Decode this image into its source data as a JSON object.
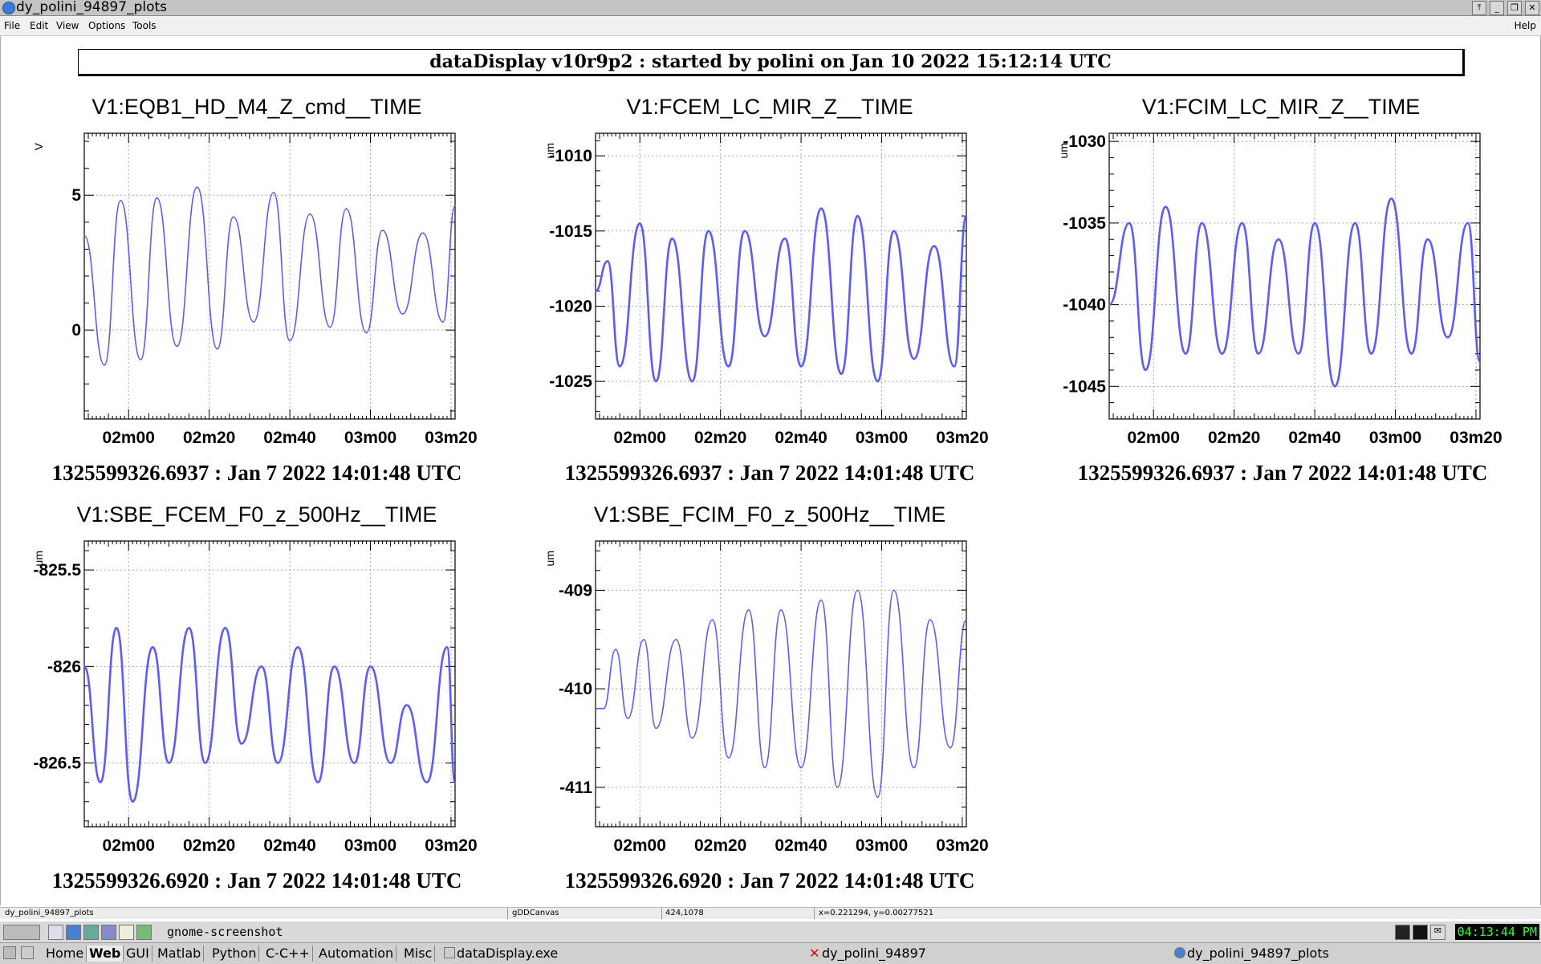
{
  "window": {
    "title": "dy_polini_94897_plots",
    "buttons": [
      "⤒",
      "_",
      "❐",
      "✕"
    ]
  },
  "menu": {
    "left": [
      "File",
      "Edit",
      "View",
      "Options",
      "Tools"
    ],
    "help": "Help"
  },
  "header": "dataDisplay v10r9p2 : started by polini on Jan 10 2022 15:12:14 UTC",
  "plots": [
    {
      "title": "V1:EQB1_HD_M4_Z_cmd__TIME",
      "ylabel": "V",
      "footer": "1325599326.6937 : Jan  7 2022 14:01:48 UTC"
    },
    {
      "title": "V1:FCEM_LC_MIR_Z__TIME",
      "ylabel": "um",
      "footer": "1325599326.6937 : Jan  7 2022 14:01:48 UTC"
    },
    {
      "title": "V1:FCIM_LC_MIR_Z__TIME",
      "ylabel": "um",
      "footer": "1325599326.6937 : Jan  7 2022 14:01:48 UTC"
    },
    {
      "title": "V1:SBE_FCEM_F0_z_500Hz__TIME",
      "ylabel": "um",
      "footer": "1325599326.6920 : Jan  7 2022 14:01:48 UTC"
    },
    {
      "title": "V1:SBE_FCIM_F0_z_500Hz__TIME",
      "ylabel": "um",
      "footer": "1325599326.6920 : Jan  7 2022 14:01:48 UTC"
    }
  ],
  "chart_data": [
    {
      "type": "line",
      "title": "V1:EQB1_HD_M4_Z_cmd__TIME",
      "ylabel": "V",
      "x_ticks": [
        "02m00",
        "02m20",
        "02m40",
        "03m00",
        "03m20"
      ],
      "y_ticks": [
        5,
        0
      ],
      "ylim": [
        -3.3,
        7.3
      ],
      "grid": true,
      "color": "#5b5bff",
      "series": [
        {
          "x": [
            0,
            5,
            9,
            14,
            18,
            23,
            28,
            33,
            37,
            42,
            47,
            51,
            56,
            61,
            65,
            70,
            74,
            79,
            84,
            89,
            92
          ],
          "y": [
            3.5,
            -1.3,
            4.8,
            -1.1,
            4.9,
            -0.6,
            5.3,
            -0.7,
            4.2,
            0.3,
            5.1,
            -0.4,
            4.3,
            0.1,
            4.5,
            -0.1,
            3.7,
            0.6,
            3.6,
            0.3,
            4.6
          ]
        }
      ]
    },
    {
      "type": "line",
      "title": "V1:FCEM_LC_MIR_Z__TIME",
      "ylabel": "um",
      "x_ticks": [
        "02m00",
        "02m20",
        "02m40",
        "03m00",
        "03m20"
      ],
      "y_ticks": [
        -1010,
        -1015,
        -1020,
        -1025
      ],
      "ylim": [
        -1027.5,
        -1008.5
      ],
      "grid": true,
      "color": "#5b5bff",
      "series": [
        {
          "x": [
            0,
            3,
            6,
            11,
            15,
            19,
            24,
            28,
            33,
            37,
            42,
            47,
            51,
            56,
            61,
            65,
            70,
            74,
            79,
            84,
            89,
            92
          ],
          "y": [
            -1019,
            -1017,
            -1024,
            -1014.5,
            -1025,
            -1015.5,
            -1025,
            -1015,
            -1024,
            -1015,
            -1022,
            -1015.5,
            -1024,
            -1013.5,
            -1024.5,
            -1014,
            -1025,
            -1015,
            -1023.5,
            -1016,
            -1024,
            -1014
          ]
        }
      ]
    },
    {
      "type": "line",
      "title": "V1:FCIM_LC_MIR_Z__TIME",
      "ylabel": "um",
      "x_ticks": [
        "02m00",
        "02m20",
        "02m40",
        "03m00",
        "03m20"
      ],
      "y_ticks": [
        -1030,
        -1035,
        -1040,
        -1045
      ],
      "ylim": [
        -1047,
        -1029.5
      ],
      "grid": true,
      "color": "#5b5bff",
      "series": [
        {
          "x": [
            0,
            5,
            9,
            14,
            19,
            23,
            28,
            33,
            37,
            42,
            47,
            51,
            56,
            61,
            65,
            70,
            75,
            79,
            84,
            89,
            92
          ],
          "y": [
            -1040,
            -1035,
            -1044,
            -1034,
            -1043,
            -1035,
            -1043,
            -1035,
            -1043,
            -1036,
            -1043,
            -1035,
            -1045,
            -1035,
            -1043,
            -1033.5,
            -1043,
            -1036,
            -1042,
            -1035,
            -1043.5
          ]
        }
      ]
    },
    {
      "type": "line",
      "title": "V1:SBE_FCEM_F0_z_500Hz__TIME",
      "ylabel": "um",
      "x_ticks": [
        "02m00",
        "02m20",
        "02m40",
        "03m00",
        "03m20"
      ],
      "y_ticks": [
        -825.5,
        -826,
        -826.5
      ],
      "ylim": [
        -826.83,
        -825.35
      ],
      "grid": true,
      "color": "#5b5bff",
      "series": [
        {
          "x": [
            0,
            4,
            8,
            12,
            17,
            21,
            26,
            30,
            35,
            39,
            44,
            48,
            53,
            58,
            62,
            67,
            71,
            76,
            80,
            85,
            90,
            92
          ],
          "y": [
            -826,
            -826.6,
            -825.8,
            -826.7,
            -825.9,
            -826.5,
            -825.8,
            -826.5,
            -825.8,
            -826.4,
            -826,
            -826.5,
            -825.9,
            -826.6,
            -826,
            -826.5,
            -826,
            -826.5,
            -826.2,
            -826.6,
            -825.9,
            -826.6
          ]
        }
      ]
    },
    {
      "type": "line",
      "title": "V1:SBE_FCIM_F0_z_500Hz__TIME",
      "ylabel": "um",
      "x_ticks": [
        "02m00",
        "02m20",
        "02m40",
        "03m00",
        "03m20"
      ],
      "y_ticks": [
        -409,
        -410,
        -411
      ],
      "ylim": [
        -411.4,
        -408.5
      ],
      "grid": true,
      "color": "#5b5bff",
      "series": [
        {
          "x": [
            0,
            2,
            5,
            8,
            12,
            15,
            20,
            24,
            29,
            33,
            38,
            42,
            46,
            51,
            56,
            60,
            65,
            70,
            74,
            79,
            83,
            88,
            92
          ],
          "y": [
            -410.2,
            -410.2,
            -409.6,
            -410.3,
            -409.5,
            -410.4,
            -409.5,
            -410.5,
            -409.3,
            -410.7,
            -409.2,
            -410.8,
            -409.2,
            -410.8,
            -409.1,
            -411,
            -409,
            -411.1,
            -409,
            -410.8,
            -409.3,
            -410.6,
            -409.3
          ]
        }
      ]
    }
  ],
  "status": {
    "window": "dy_polini_94897_plots",
    "canvas": "gDDCanvas",
    "pos": "424,1078",
    "coords": "x=0.221294, y=0.00277521"
  },
  "cmdbar": {
    "text": "gnome-screenshot",
    "clock": "04:13:44 PM"
  },
  "taskbar": {
    "buttons": [
      "Home",
      "Web",
      "GUI",
      "Matlab",
      "Python",
      "C-C++",
      "Automation",
      "Misc"
    ],
    "active": "Web",
    "tasks": [
      "dataDisplay.exe",
      "dy_polini_94897",
      "dy_polini_94897_plots"
    ]
  }
}
